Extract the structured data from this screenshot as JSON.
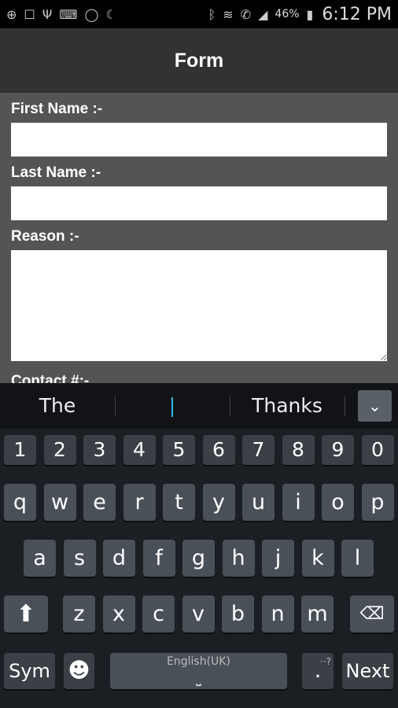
{
  "status": {
    "battery": "46%",
    "time": "6:12 PM",
    "icons": [
      "notification-plus-icon",
      "screenshot-icon",
      "usb-icon",
      "keyboard-icon",
      "whatsapp-icon",
      "moon-app-icon",
      "bluetooth-icon",
      "wifi-icon",
      "phone-icon",
      "signal-icon",
      "battery-charging-icon"
    ]
  },
  "header": {
    "title": "Form"
  },
  "form": {
    "first_name_label": "First Name :-",
    "first_name_value": "",
    "last_name_label": "Last Name :-",
    "last_name_value": "",
    "reason_label": "Reason :-",
    "reason_value": "",
    "contact_label": "Contact #:-"
  },
  "suggestions": [
    "The",
    "|",
    "Thanks"
  ],
  "keyboard": {
    "row1": [
      "1",
      "2",
      "3",
      "4",
      "5",
      "6",
      "7",
      "8",
      "9",
      "0"
    ],
    "row2": [
      "q",
      "w",
      "e",
      "r",
      "t",
      "y",
      "u",
      "i",
      "o",
      "p"
    ],
    "row3": [
      "a",
      "s",
      "d",
      "f",
      "g",
      "h",
      "j",
      "k",
      "l"
    ],
    "row4": [
      "z",
      "x",
      "c",
      "v",
      "b",
      "n",
      "m"
    ],
    "sym": "Sym",
    "space": "English(UK)",
    "period": ".",
    "period_hint": "··?",
    "next": "Next"
  },
  "colors": {
    "header": "#323232",
    "form_bg": "#545454",
    "key": "#4a5058",
    "cursor": "#33b5e5"
  }
}
